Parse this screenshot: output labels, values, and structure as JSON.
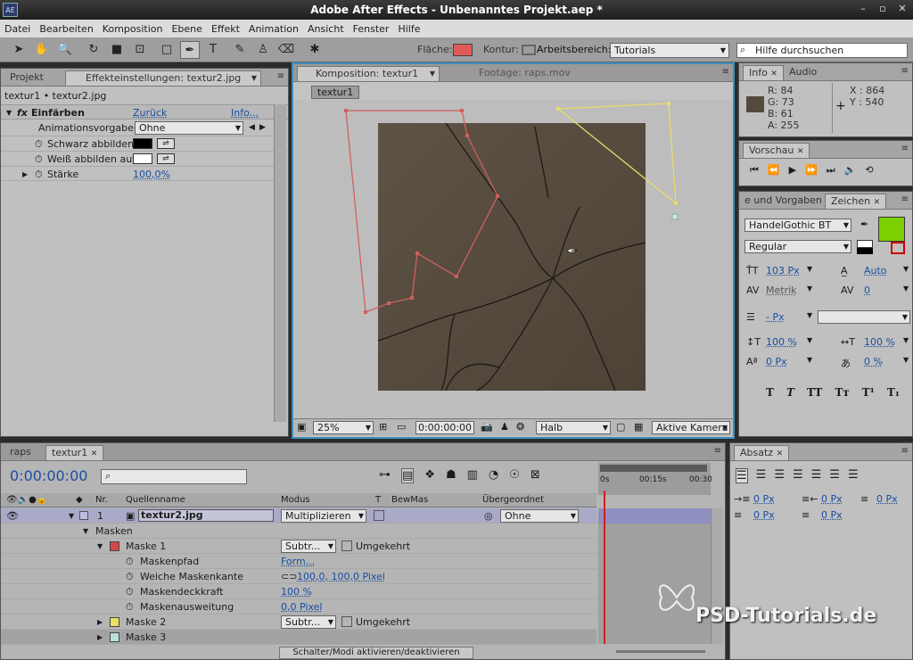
{
  "window": {
    "title": "Adobe After Effects - Unbenanntes Projekt.aep *",
    "logo": "AE",
    "controls": [
      "–",
      "▫",
      "✕"
    ]
  },
  "menu": [
    "Datei",
    "Bearbeiten",
    "Komposition",
    "Ebene",
    "Effekt",
    "Animation",
    "Ansicht",
    "Fenster",
    "Hilfe"
  ],
  "toolbar": {
    "fill_label": "Fläche:",
    "fill_color": "#e05a5a",
    "stroke_label": "Kontur:",
    "workspace_label": "Arbeitsbereich:",
    "workspace_value": "Tutorials",
    "search_placeholder": "Hilfe durchsuchen"
  },
  "project_tabs": [
    "Projekt",
    "Effekteinstellungen: textur2.jpg"
  ],
  "effects": {
    "layer_path": "textur1 • textur2.jpg",
    "effect_name": "Einfärben",
    "reset": "Zurück",
    "info": "Info...",
    "preset_label": "Animationsvorgaben:",
    "preset_value": "Ohne",
    "black_label": "Schwarz abbilden",
    "white_label": "Weiß abbilden auf",
    "strength_label": "Stärke",
    "strength_value": "100,0%",
    "black_color": "#000000",
    "white_color": "#ffffff"
  },
  "comp_tabs": [
    "Komposition: textur1",
    "Footage: raps.mov"
  ],
  "comp": {
    "breadcrumb": "textur1",
    "zoom": "25%",
    "timecode": "0:00:00:00",
    "resolution": "Halb",
    "camera": "Aktive Kamera"
  },
  "info": {
    "tabs": [
      "Info",
      "Audio"
    ],
    "r": "R: 84",
    "g": "G: 73",
    "b": "B: 61",
    "a": "A: 255",
    "x": "X : 864",
    "y": "Y : 540",
    "sample_color": "#54493d"
  },
  "preview": {
    "tab": "Vorschau"
  },
  "char": {
    "tabs": [
      "e und Vorgaben",
      "Zeichen"
    ],
    "font": "HandelGothic BT",
    "style": "Regular",
    "size": "103 Px",
    "leading": "Auto",
    "kerning": "Metrik",
    "tracking": "0",
    "stroke": "- Px",
    "vscale": "100 %",
    "hscale": "100 %",
    "baseline": "0 Px",
    "tsume": "0 %",
    "color": "#7ed000",
    "styles": [
      "T",
      "T",
      "TT",
      "Tт",
      "T¹",
      "T₁"
    ]
  },
  "para": {
    "tab": "Absatz",
    "v1": "0 Px",
    "v2": "0 Px",
    "v3": "0 Px",
    "v4": "0 Px",
    "v5": "0 Px"
  },
  "timeline": {
    "tabs": [
      "raps",
      "textur1"
    ],
    "timecode": "0:00:00:00",
    "ruler": [
      "0s",
      "00:15s",
      "00:30"
    ],
    "cols": {
      "nr": "Nr.",
      "source": "Quellenname",
      "mode": "Modus",
      "t": "T",
      "trkmat": "BewMas",
      "parent": "Übergeordnet"
    },
    "layer": {
      "num": "1",
      "name": "textur2.jpg",
      "mode": "Multiplizieren",
      "parent": "Ohne"
    },
    "masks_label": "Masken",
    "mask1": {
      "name": "Maske 1",
      "color": "#d04848",
      "mode": "Subtr...",
      "invert": "Umgekehrt"
    },
    "props": [
      {
        "label": "Maskenpfad",
        "value": "Form..."
      },
      {
        "label": "Weiche Maskenkante",
        "value": "100,0, 100,0 Pixel"
      },
      {
        "label": "Maskendeckkraft",
        "value": "100 %"
      },
      {
        "label": "Maskenausweitung",
        "value": "0,0 Pixel"
      }
    ],
    "mask2": {
      "name": "Maske 2",
      "color": "#e8e060",
      "mode": "Subtr...",
      "invert": "Umgekehrt"
    },
    "mask3": {
      "name": "Maske 3",
      "color": "#b8e0d8"
    },
    "toggle": "Schalter/Modi aktivieren/deaktivieren"
  },
  "watermark": "PSD-Tutorials.de"
}
